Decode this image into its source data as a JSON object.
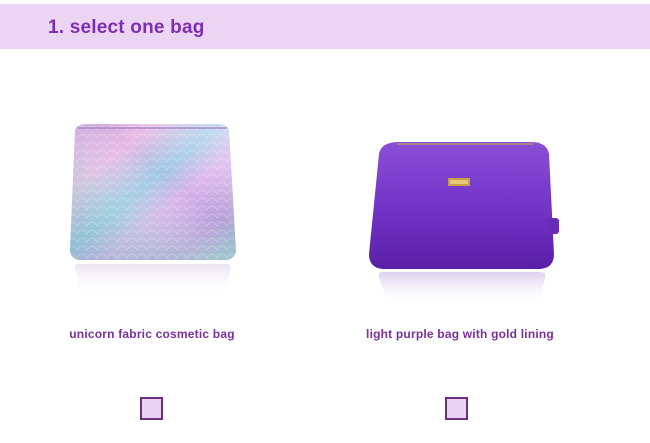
{
  "colors": {
    "accent": "#7d2eb3",
    "header_bg": "#ecd5f3",
    "checkbox_fill": "#e7d2f2",
    "checkbox_border": "#6c2f7d"
  },
  "header": {
    "title": "1. select one bag"
  },
  "options": [
    {
      "label": "unicorn fabric cosmetic bag",
      "icon": "holographic-bag-image",
      "checked": false
    },
    {
      "label": "light purple bag with gold lining",
      "icon": "purple-bag-image",
      "checked": false
    }
  ]
}
